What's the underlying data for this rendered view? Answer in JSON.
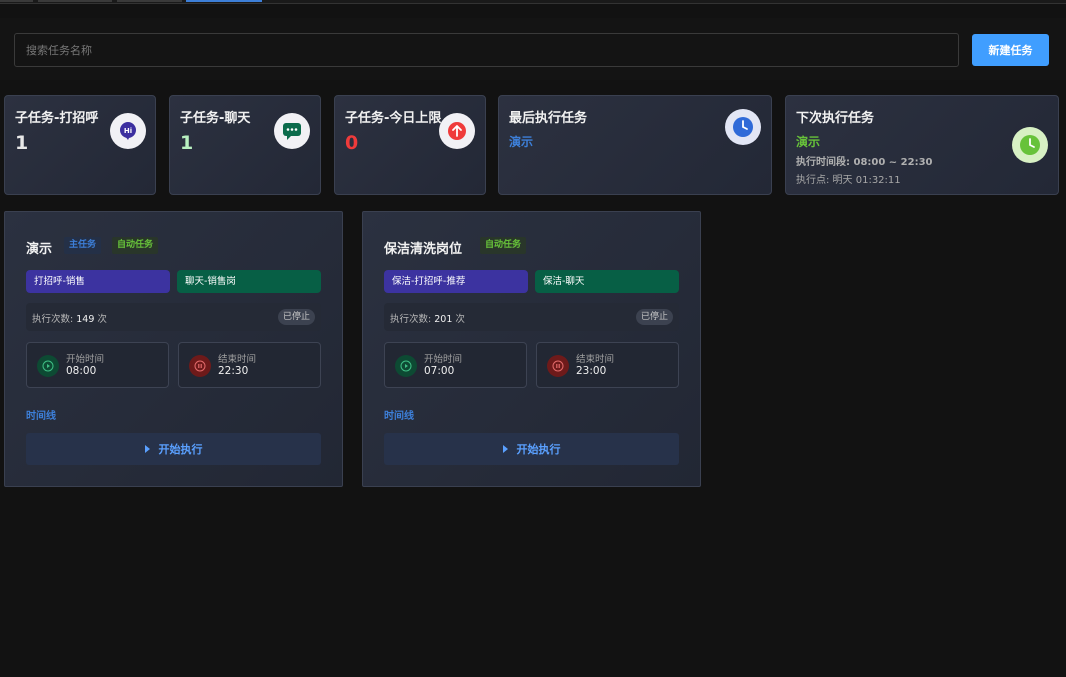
{
  "search": {
    "placeholder": "搜索任务名称",
    "value": ""
  },
  "toolbar": {
    "new_task_label": "新建任务"
  },
  "stats": [
    {
      "title": "子任务-打招呼",
      "value": "1",
      "value_color": "#e8e8e8",
      "icon": "hi-bubble-icon",
      "icon_text": "Hi"
    },
    {
      "title": "子任务-聊天",
      "value": "1",
      "value_color": "#b8f0c0",
      "icon": "chat-bubble-icon"
    },
    {
      "title": "子任务-今日上限",
      "value": "0",
      "value_color": "#ef3b3b",
      "icon": "arrow-up-icon"
    },
    {
      "title": "最后执行任务",
      "link": "演示",
      "icon": "clock-icon"
    },
    {
      "title": "下次执行任务",
      "name": "演示",
      "period": "执行时间段: 08:00 ~ 22:30",
      "point": "执行点: 明天 01:32:11",
      "icon": "clock-icon"
    }
  ],
  "tasks": [
    {
      "name": "演示",
      "tags": [
        "主任务",
        "自动任务"
      ],
      "subtasks": [
        "打招呼-销售",
        "聊天-销售岗"
      ],
      "exec_label": "执行次数:",
      "exec_count": "149",
      "exec_unit": "次",
      "status": "已停止",
      "start_label": "开始时间",
      "start_time": "08:00",
      "end_label": "结束时间",
      "end_time": "22:30",
      "timeline_label": "时间线",
      "run_label": "开始执行"
    },
    {
      "name": "保洁清洗岗位",
      "tags": [
        "自动任务"
      ],
      "subtasks": [
        "保洁-打招呼-推荐",
        "保洁-聊天"
      ],
      "exec_label": "执行次数:",
      "exec_count": "201",
      "exec_unit": "次",
      "status": "已停止",
      "start_label": "开始时间",
      "start_time": "07:00",
      "end_label": "结束时间",
      "end_time": "23:00",
      "timeline_label": "时间线",
      "run_label": "开始执行"
    }
  ],
  "colors": {
    "accent": "#409eff",
    "link": "#3d7fd8",
    "success": "#67c23a",
    "danger": "#ef3b3b"
  }
}
